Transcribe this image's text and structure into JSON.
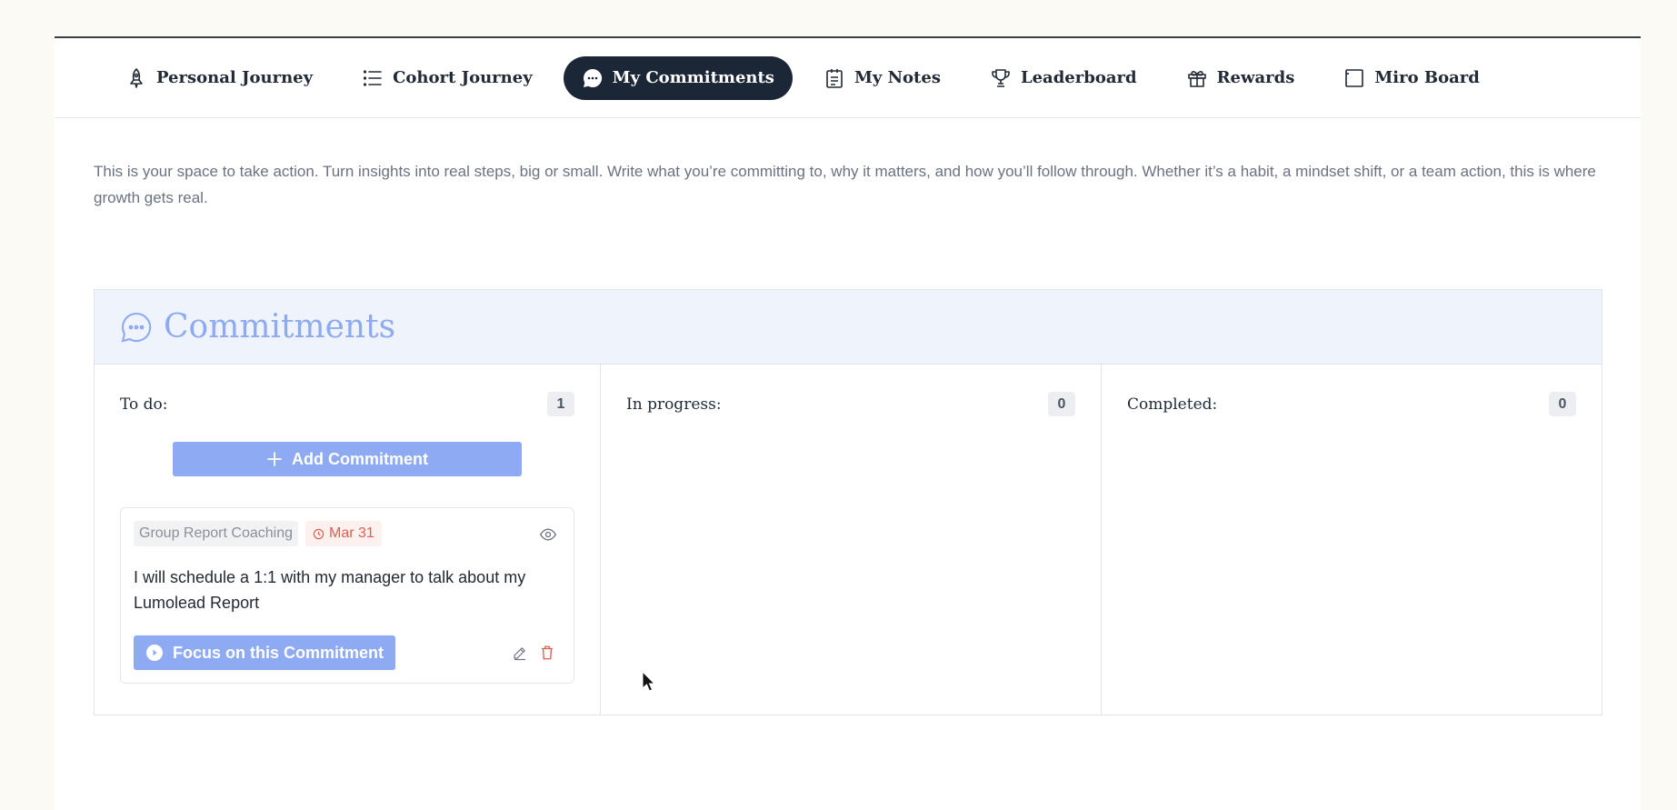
{
  "nav": {
    "items": [
      {
        "label": "Personal Journey",
        "icon": "rocket-icon",
        "active": false
      },
      {
        "label": "Cohort Journey",
        "icon": "list-icon",
        "active": false
      },
      {
        "label": "My Commitments",
        "icon": "chat-bubble-icon",
        "active": true
      },
      {
        "label": "My Notes",
        "icon": "notes-icon",
        "active": false
      },
      {
        "label": "Leaderboard",
        "icon": "trophy-icon",
        "active": false
      },
      {
        "label": "Rewards",
        "icon": "gift-icon",
        "active": false
      },
      {
        "label": "Miro Board",
        "icon": "board-icon",
        "active": false
      }
    ]
  },
  "intro": "This is your space to take action. Turn insights into real steps, big or small. Write what you’re committing to, why it matters, and how you’ll follow through. Whether it’s a habit, a mindset shift, or a team action, this is where growth gets real.",
  "board": {
    "title": "Commitments",
    "columns": [
      {
        "title": "To do:",
        "count": "1"
      },
      {
        "title": "In progress:",
        "count": "0"
      },
      {
        "title": "Completed:",
        "count": "0"
      }
    ],
    "add_label": "Add Commitment",
    "card": {
      "tag": "Group Report Coaching",
      "due": "Mar 31",
      "text": "I will schedule a 1:1 with my manager to talk about my Lumolead Report",
      "focus_label": "Focus on this Commitment"
    }
  },
  "colors": {
    "active_nav_bg": "#1b2636",
    "accent": "#8eaaf3",
    "header_bg": "#eff3fb",
    "danger": "#e05d50"
  }
}
